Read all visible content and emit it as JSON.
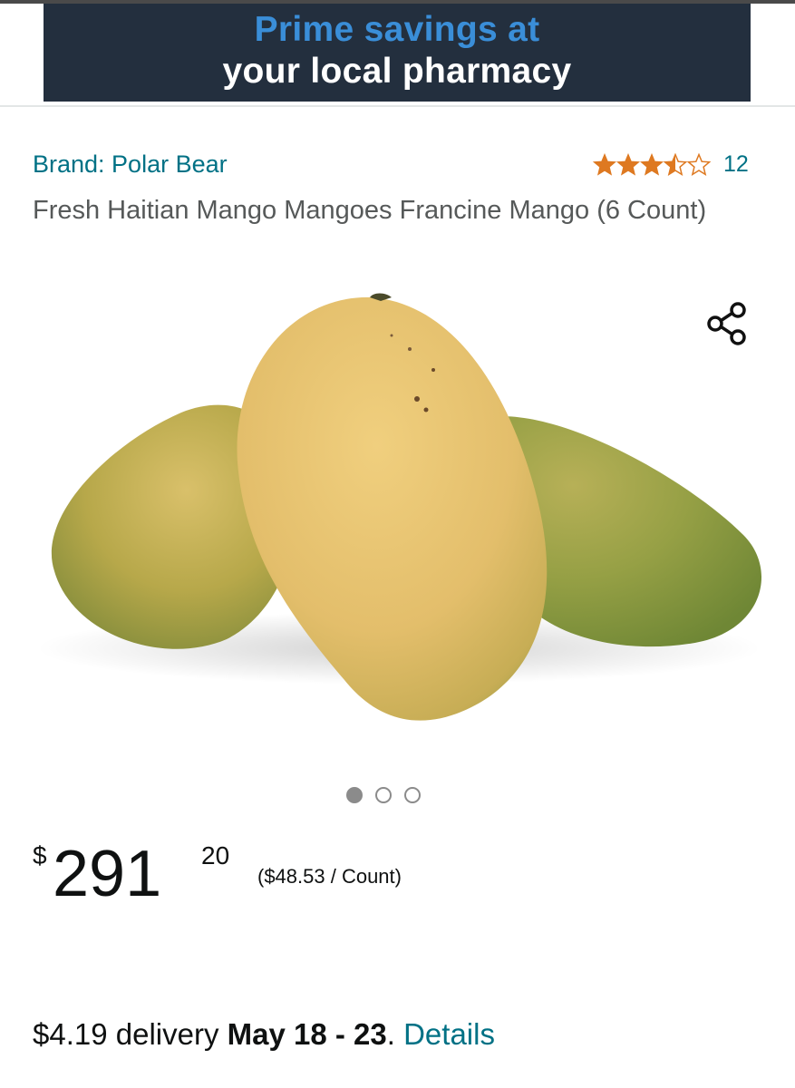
{
  "banner": {
    "line1": "Prime savings at",
    "line2": "your local pharmacy"
  },
  "product": {
    "brand": "Brand: Polar Bear",
    "rating": {
      "stars": 3.5,
      "max": 5,
      "count": "12"
    },
    "title": "Fresh Haitian Mango Mangoes Francine Mango (6 Count)",
    "image_alt": "mango-product-image"
  },
  "carousel": {
    "count": 3,
    "active": 0
  },
  "price": {
    "symbol": "$",
    "whole": "291",
    "fraction": "20",
    "per_unit": "($48.53 / Count)"
  },
  "delivery": {
    "cost": "$4.19 delivery",
    "dates": "May 18 - 23",
    "period": ".",
    "details": "Details"
  },
  "colors": {
    "banner_bg": "#232f3e",
    "banner_accent": "#3a8ed8",
    "link": "#007185",
    "star": "#de7921"
  }
}
